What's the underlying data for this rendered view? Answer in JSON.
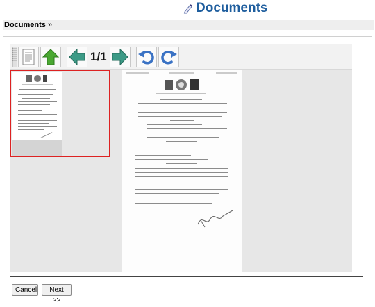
{
  "header": {
    "title": "Documents",
    "icon": "pencil-icon"
  },
  "breadcrumb": {
    "label": "Documents",
    "separator": "»"
  },
  "viewer": {
    "page_indicator": "1/1",
    "toolbar": [
      "document-icon",
      "up-arrow-icon",
      "left-arrow-icon",
      "right-arrow-icon",
      "rotate-left-icon",
      "rotate-right-icon"
    ]
  },
  "footer": {
    "cancel_label": "Cancel",
    "next_label": "Next >>"
  },
  "colors": {
    "title": "#1f5e9e",
    "arrow_green": "#4aa832",
    "arrow_teal": "#3c9a86",
    "rotate_blue": "#3a72c4",
    "thumb_border": "#dd2222"
  }
}
